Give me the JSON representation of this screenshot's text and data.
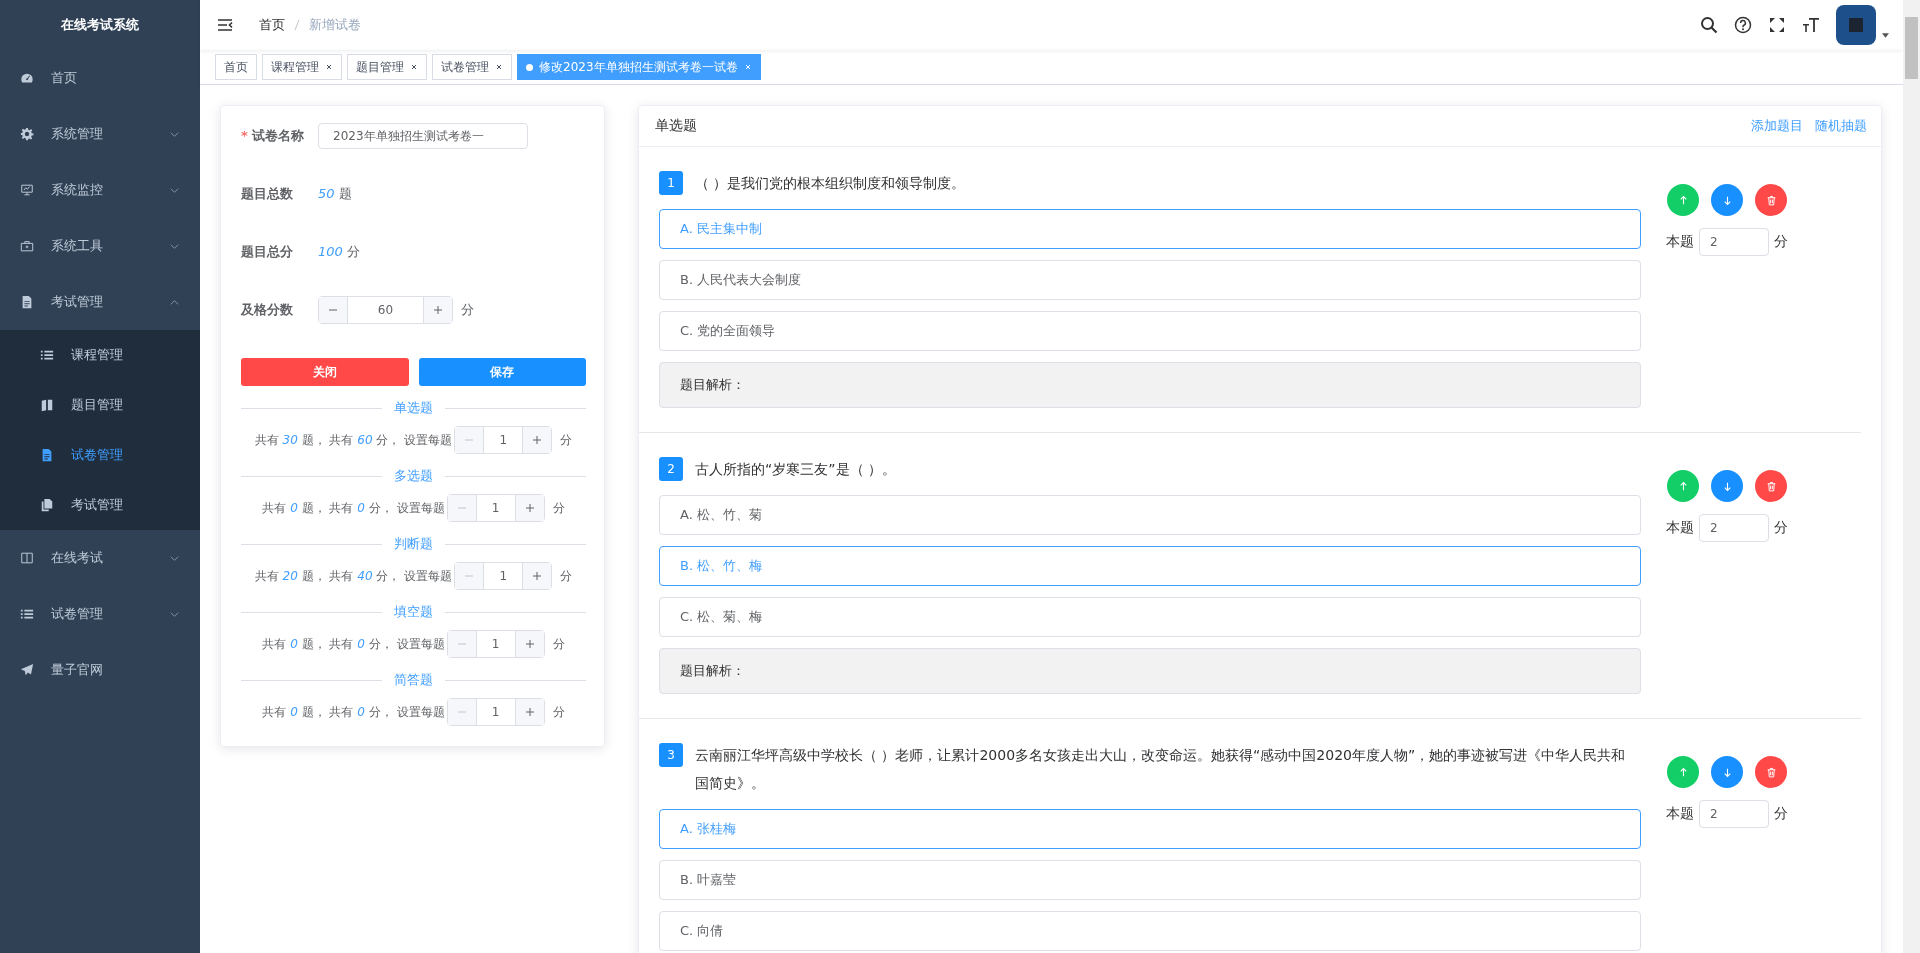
{
  "sidebar": {
    "title": "在线考试系统",
    "items": [
      {
        "label": "首页",
        "selected": false
      },
      {
        "label": "系统管理",
        "selected": false,
        "expanded": false
      },
      {
        "label": "系统监控",
        "selected": false,
        "expanded": false
      },
      {
        "label": "系统工具",
        "selected": false,
        "expanded": false
      },
      {
        "label": "考试管理",
        "selected": false,
        "expanded": true,
        "children": [
          {
            "label": "课程管理",
            "selected": false
          },
          {
            "label": "题目管理",
            "selected": false
          },
          {
            "label": "试卷管理",
            "selected": true
          },
          {
            "label": "考试管理",
            "selected": false
          }
        ]
      },
      {
        "label": "在线考试",
        "selected": false,
        "expanded": false
      },
      {
        "label": "试卷管理",
        "selected": false,
        "expanded": false
      },
      {
        "label": "量子官网",
        "selected": false
      }
    ]
  },
  "breadcrumb": [
    "首页",
    "新增试卷"
  ],
  "tags": [
    {
      "label": "首页",
      "selected": false,
      "closable": false
    },
    {
      "label": "课程管理",
      "selected": false,
      "closable": true
    },
    {
      "label": "题目管理",
      "selected": false,
      "closable": true
    },
    {
      "label": "试卷管理",
      "selected": false,
      "closable": true
    },
    {
      "label": "修改2023年单独招生测试考卷一试卷",
      "selected": true,
      "closable": true
    }
  ],
  "form": {
    "paper_name": {
      "label": "试卷名称",
      "required_mark": "*",
      "value": "2023年单独招生测试考卷一"
    },
    "totals": [
      {
        "label": "题目总数",
        "value": "50",
        "unit": "题"
      },
      {
        "label": "题目总分",
        "value": "100",
        "unit": "分"
      }
    ],
    "pass_score": {
      "label": "及格分数",
      "value": "60",
      "unit": "分",
      "minus_disabled": false
    },
    "buttons": [
      {
        "label": "关闭",
        "kind": "danger"
      },
      {
        "label": "保存",
        "kind": "primary"
      }
    ],
    "sections": [
      {
        "title": "单选题",
        "summary": "共有 *30* 题， 共有 *60* 分， 设置每题",
        "value": "1",
        "unit": "分",
        "minus_disabled": true
      },
      {
        "title": "多选题",
        "summary": "共有 *0* 题， 共有 *0* 分， 设置每题",
        "value": "1",
        "unit": "分",
        "minus_disabled": true
      },
      {
        "title": "判断题",
        "summary": "共有 *20* 题， 共有 *40* 分， 设置每题",
        "value": "1",
        "unit": "分",
        "minus_disabled": true
      },
      {
        "title": "填空题",
        "summary": "共有 *0* 题， 共有 *0* 分， 设置每题",
        "value": "1",
        "unit": "分",
        "minus_disabled": true
      },
      {
        "title": "简答题",
        "summary": "共有 *0* 题， 共有 *0* 分， 设置每题",
        "value": "1",
        "unit": "分",
        "minus_disabled": true
      }
    ]
  },
  "questions": {
    "title": "单选题",
    "actions": [
      "添加题目",
      "随机抽题"
    ],
    "items": [
      {
        "number": "1",
        "text": "（ ）是我们党的根本组织制度和领导制度。",
        "options": [
          {
            "label": "A. 民主集中制",
            "selected": true
          },
          {
            "label": "B. 人民代表大会制度",
            "selected": false
          },
          {
            "label": "C. 党的全面领导",
            "selected": false
          }
        ],
        "analysis": "题目解析：",
        "score_label": "本题",
        "score": "2",
        "unit": "分"
      },
      {
        "number": "2",
        "text": "古人所指的“岁寒三友”是（ ）。",
        "options": [
          {
            "label": "A. 松、竹、菊",
            "selected": false
          },
          {
            "label": "B. 松、竹、梅",
            "selected": true
          },
          {
            "label": "C. 松、菊、梅",
            "selected": false
          }
        ],
        "analysis": "题目解析：",
        "score_label": "本题",
        "score": "2",
        "unit": "分"
      },
      {
        "number": "3",
        "text": "云南丽江华坪高级中学校长（ ）老师，让累计2000多名女孩走出大山，改变命运。她获得“感动中国2020年度人物”，她的事迹被写进《中华人民共和国简史》。",
        "options": [
          {
            "label": "A. 张桂梅",
            "selected": true
          },
          {
            "label": "B. 叶嘉莹",
            "selected": false
          },
          {
            "label": "C. 向倩",
            "selected": false
          }
        ],
        "score_label": "本题",
        "score": "2",
        "unit": "分"
      }
    ]
  }
}
